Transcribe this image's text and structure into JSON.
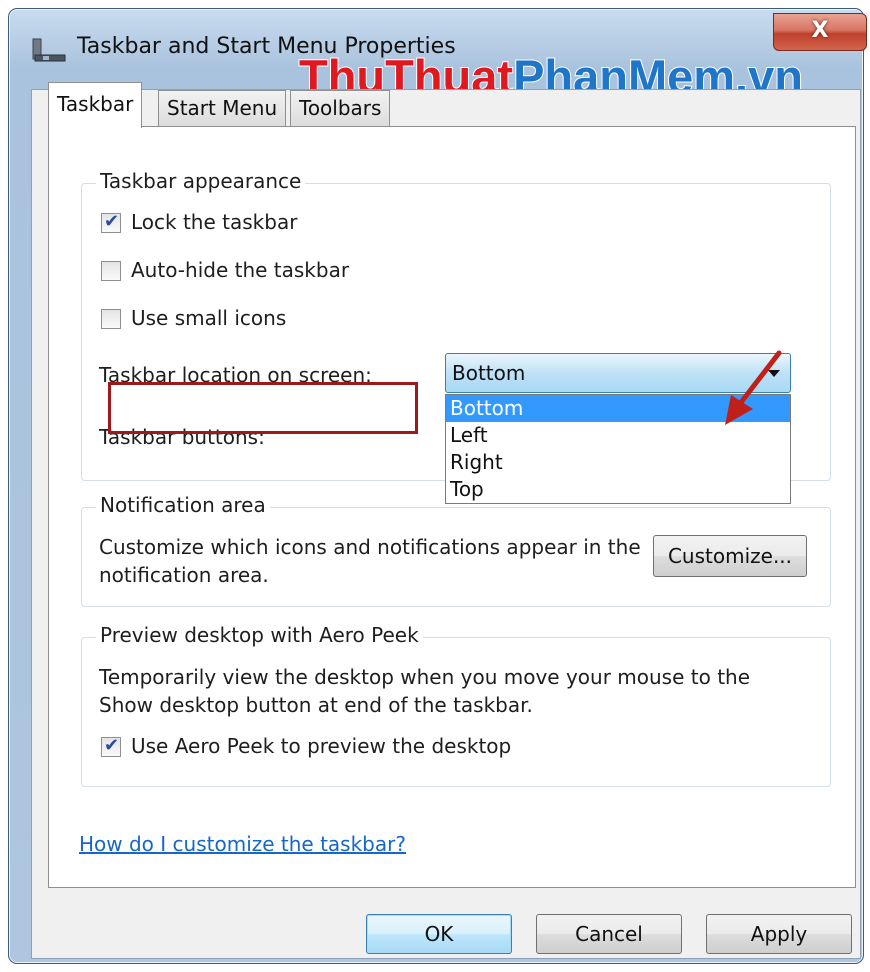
{
  "window": {
    "title": "Taskbar and Start Menu Properties",
    "close_label": "X"
  },
  "watermark": {
    "part1": "ThuThuat",
    "part2": "PhanMem.vn"
  },
  "tabs": [
    {
      "label": "Taskbar",
      "active": true
    },
    {
      "label": "Start Menu",
      "active": false
    },
    {
      "label": "Toolbars",
      "active": false
    }
  ],
  "appearance": {
    "title": "Taskbar appearance",
    "lock": {
      "label": "Lock the taskbar",
      "checked": true
    },
    "autohide": {
      "label": "Auto-hide the taskbar",
      "checked": false
    },
    "small_icons": {
      "label": "Use small icons",
      "checked": false
    },
    "location_label": "Taskbar location on screen:",
    "location_value": "Bottom",
    "location_options": [
      "Bottom",
      "Left",
      "Right",
      "Top"
    ],
    "buttons_label": "Taskbar buttons:"
  },
  "notification": {
    "title": "Notification area",
    "text_line1": "Customize which icons and notifications appear in the",
    "text_line2": "notification area.",
    "customize_label": "Customize..."
  },
  "peek": {
    "title": "Preview desktop with Aero Peek",
    "text_line1": "Temporarily view the desktop when you move your mouse to the",
    "text_line2": "Show desktop button at end of the taskbar.",
    "use_peek": {
      "label": "Use Aero Peek to preview the desktop",
      "checked": true
    }
  },
  "help_link": "How do I customize the taskbar?",
  "footer": {
    "ok": "OK",
    "cancel": "Cancel",
    "apply": "Apply"
  },
  "colors": {
    "highlight_box": "#9e1a1a",
    "selection": "#3399ff",
    "link": "#1767c7",
    "arrow": "#c0201a"
  }
}
